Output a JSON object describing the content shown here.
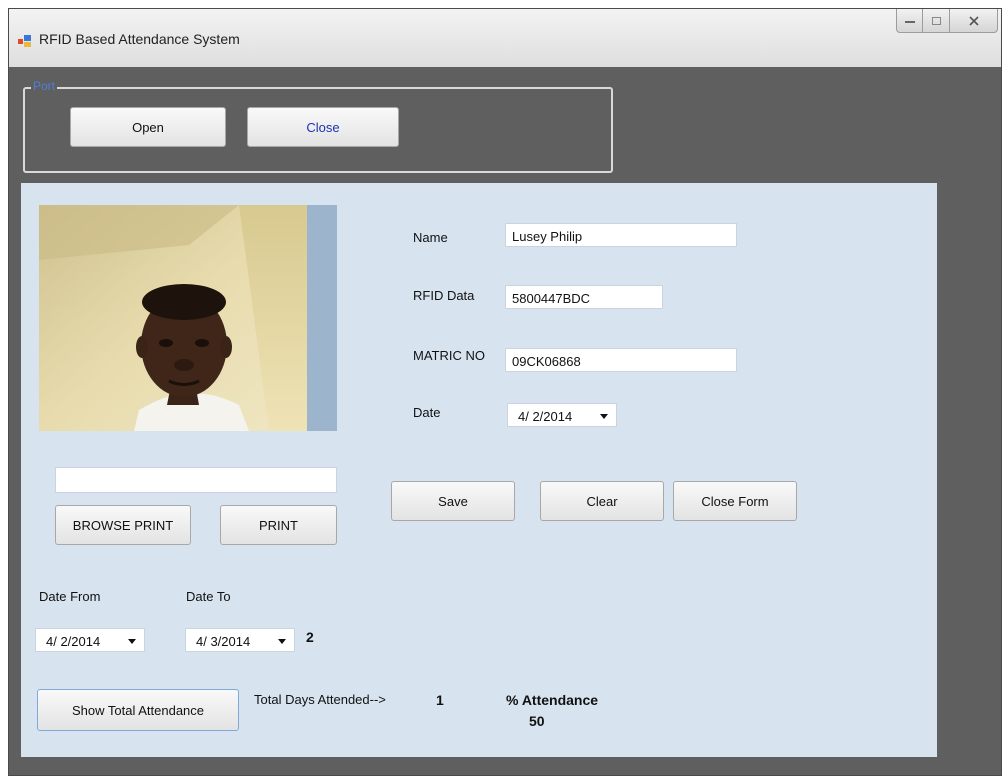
{
  "window": {
    "title": "RFID Based Attendance System",
    "controls": {
      "minimize": "▭",
      "maximize": "□",
      "close": "X"
    }
  },
  "port": {
    "legend": "Port",
    "open_label": "Open",
    "close_label": "Close"
  },
  "photo": {
    "path": ""
  },
  "form": {
    "name_label": "Name",
    "name_value": "Lusey Philip",
    "rfid_label": "RFID Data",
    "rfid_value": "5800447BDC",
    "matric_label": "MATRIC NO",
    "matric_value": "09CK06868",
    "date_label": "Date",
    "date_value": "4/ 2/2014"
  },
  "actions": {
    "save_label": "Save",
    "clear_label": "Clear",
    "close_form_label": "Close Form",
    "browse_print_label": "BROWSE PRINT",
    "print_label": "PRINT"
  },
  "range": {
    "from_label": "Date From",
    "from_value": "4/ 2/2014",
    "to_label": "Date To",
    "to_value": "4/ 3/2014",
    "days_count": "2"
  },
  "attendance": {
    "show_total_label": "Show Total Attendance",
    "total_days_label": "Total Days Attended-->",
    "total_days_value": "1",
    "percent_label": "% Attendance",
    "percent_value": "50"
  },
  "colors": {
    "panel_bg": "#d7e4f0",
    "window_bg": "#5f5f5f",
    "legend_text": "#4f7fd8",
    "close_text": "#1a33b3"
  }
}
